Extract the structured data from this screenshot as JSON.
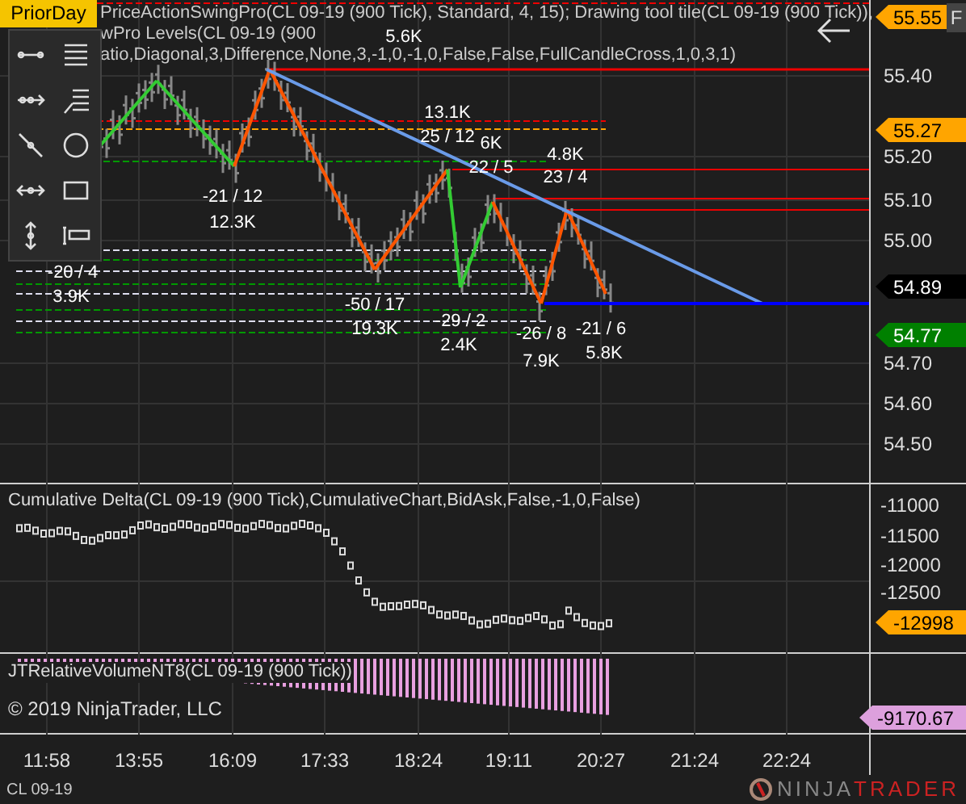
{
  "prior_day_button": "PriorDay",
  "indicator_legends": [
    "PriceActionSwingPro(CL 09-19 (900 Tick), Standard, 4, 15); Drawing tool tile(CL 09-19 (900 Tick)),",
    "wPro Levels(CL 09-19 (900",
    "atio,Diagonal,3,Difference,None,3,-1,0,-1,0,False,False,FullCandleCross,1,0,3,1)"
  ],
  "swing_labels": [
    "5.6K",
    "13.1K",
    "25 / 12",
    "6K",
    "22 / 5",
    "4.8K",
    "23 / 4",
    "-21 / 12",
    "12.3K",
    "-20 / 4",
    "3.9K",
    "-50 / 17",
    "19.3K",
    "-29 / 2",
    "2.4K",
    "-26 / 8",
    "7.9K",
    "-21 / 6",
    "5.8K"
  ],
  "price_axis": {
    "ticks": [
      "55.40",
      "55.20",
      "55.10",
      "55.00",
      "54.70",
      "54.60",
      "54.50"
    ],
    "badges": [
      {
        "value": "55.55",
        "color": "#ffa500"
      },
      {
        "value": "55.27",
        "color": "#ffa500"
      },
      {
        "value": "54.89",
        "color": "#000000"
      },
      {
        "value": "54.77",
        "color": "#008000"
      }
    ]
  },
  "f_button": "F",
  "delta_panel": {
    "legend": "Cumulative Delta(CL 09-19 (900 Tick),CumulativeChart,BidAsk,False,-1,0,False)",
    "ticks": [
      "-11000",
      "-11500",
      "-12000",
      "-12500"
    ],
    "badge": {
      "value": "-12998",
      "color": "#ffa500"
    }
  },
  "volume_panel": {
    "legend": "JTRelativeVolumeNT8(CL 09-19 (900 Tick))",
    "copyright": "© 2019 NinjaTrader, LLC",
    "badge": {
      "value": "-9170.67",
      "color": "#dda0dd"
    }
  },
  "time_axis": [
    "11:58",
    "13:55",
    "16:09",
    "17:33",
    "18:24",
    "19:11",
    "20:27",
    "21:24",
    "22:24"
  ],
  "status_bar": {
    "instrument": "CL 09-19",
    "logo_left": "NINJA",
    "logo_right": "TRADER"
  }
}
